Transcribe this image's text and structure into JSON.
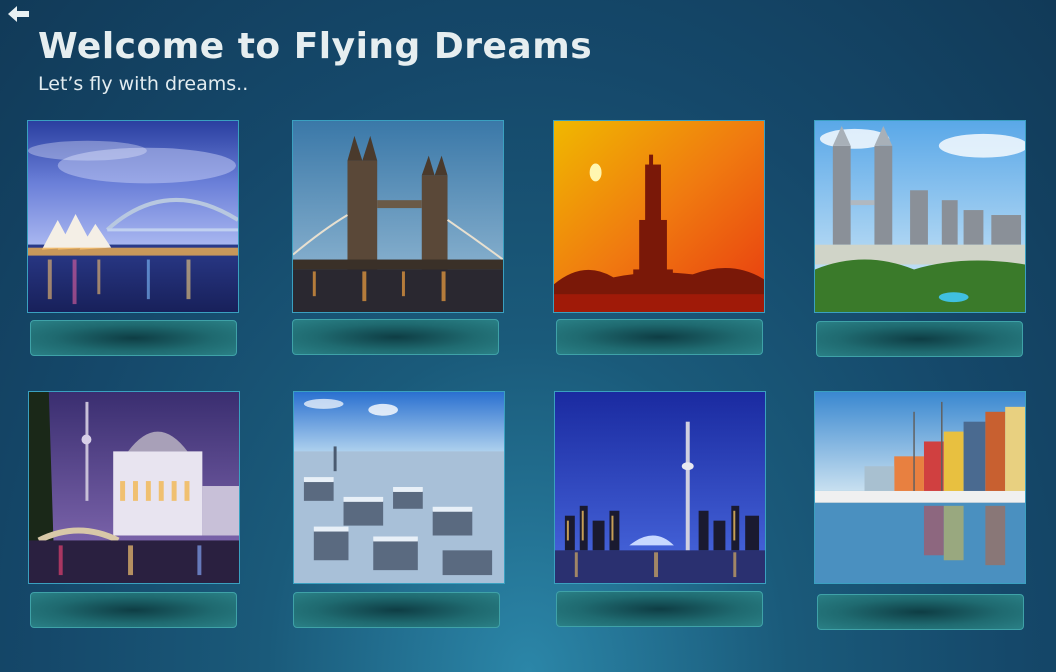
{
  "header": {
    "back_icon": "arrow-left-icon",
    "title": "Welcome to Flying Dreams",
    "subtitle": "Let’s fly with dreams.."
  },
  "destinations": [
    {
      "scene": "sydney-opera-house-harbour-bridge",
      "label": ""
    },
    {
      "scene": "london-tower-bridge",
      "label": ""
    },
    {
      "scene": "statue-of-liberty-sunset",
      "label": ""
    },
    {
      "scene": "kuala-lumpur-petronas-towers",
      "label": ""
    },
    {
      "scene": "berlin-bode-museum-tv-tower",
      "label": ""
    },
    {
      "scene": "snowy-city-aerial",
      "label": ""
    },
    {
      "scene": "toronto-cn-tower-skyline",
      "label": ""
    },
    {
      "scene": "copenhagen-nyhavn",
      "label": ""
    }
  ],
  "colors": {
    "background": "#15486a",
    "button": "#1f6a70",
    "button_border": "#3fa2a8"
  }
}
